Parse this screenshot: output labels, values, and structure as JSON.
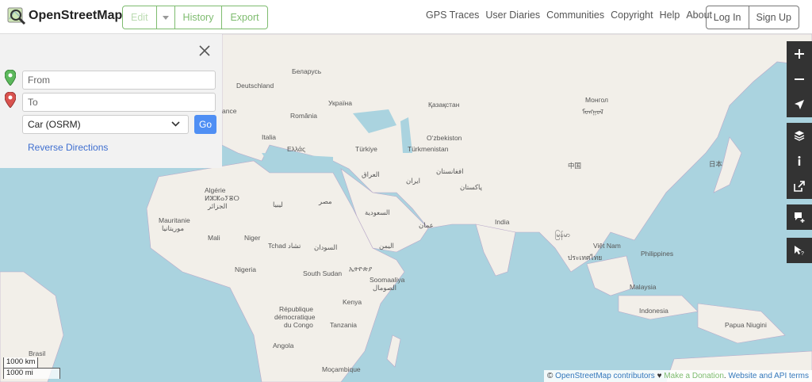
{
  "header": {
    "brand": "OpenStreetMap",
    "edit_label": "Edit",
    "history_label": "History",
    "export_label": "Export",
    "nav": [
      "GPS Traces",
      "User Diaries",
      "Communities",
      "Copyright",
      "Help",
      "About"
    ],
    "login_label": "Log In",
    "signup_label": "Sign Up"
  },
  "directions": {
    "from_placeholder": "From",
    "to_placeholder": "To",
    "engine": "Car (OSRM)",
    "go_label": "Go",
    "reverse_label": "Reverse Directions"
  },
  "scale": {
    "km": "1000 km",
    "mi": "1000 mi"
  },
  "attribution": {
    "copy": "©",
    "contributors": "OpenStreetMap contributors",
    "heart": "♥",
    "donate": "Make a Donation",
    "api": "Website and API terms"
  },
  "map_labels": {
    "deutschland": "Deutschland",
    "belarus": "Беларусь",
    "ukraina": "Україна",
    "romania": "România",
    "france": "ance",
    "italia": "Italia",
    "ellas": "Ελλάς",
    "turkiye": "Türkiye",
    "kazakhstan": "Қазақстан",
    "uzbekiston": "O‘zbekiston",
    "turkmenistan": "Türkmenistan",
    "mongol": "Монгол",
    "mongol2": "ᠮᠣᠩᠭᠣᠯ",
    "zhongguo": "中国",
    "nihon": "日本",
    "iraq": "العراق",
    "iran": "ایران",
    "afghanistan": "افغانستان",
    "pakistan": "پاکستان",
    "saudi": "السعودية",
    "oman": "عمان",
    "yemen": "اليمن",
    "india": "India",
    "myanmar": "မြန်မာ",
    "thailand": "ประเทศไทย",
    "vietnam": "Việt Nam",
    "philippines": "Philippines",
    "malaysia": "Malaysia",
    "indonesia": "Indonesia",
    "papua": "Papua Niugini",
    "algerie": "Algérie",
    "algerie2": "ⵍⵣⵣⴰⵢⴻⵔ",
    "algerie3": "الجزائر",
    "libya": "ليبيا",
    "misr": "مصر",
    "mauritanie": "Mauritanie",
    "mauritanie2": "موريتانيا",
    "mali": "Mali",
    "niger": "Niger",
    "tchad": "Tchad تشاد",
    "sudan": "السودان",
    "nigeria": "Nigeria",
    "south_sudan": "South Sudan",
    "ethiopia": "ኢትዮጵያ",
    "somalia": "Soomaaliya",
    "somalia2": "الصومال",
    "kenya": "Kenya",
    "rdc1": "République",
    "rdc2": "démocratique",
    "rdc3": "du Congo",
    "tanzania": "Tanzania",
    "angola": "Angola",
    "brasil": "Brasil",
    "mocambique": "Moçambique"
  }
}
